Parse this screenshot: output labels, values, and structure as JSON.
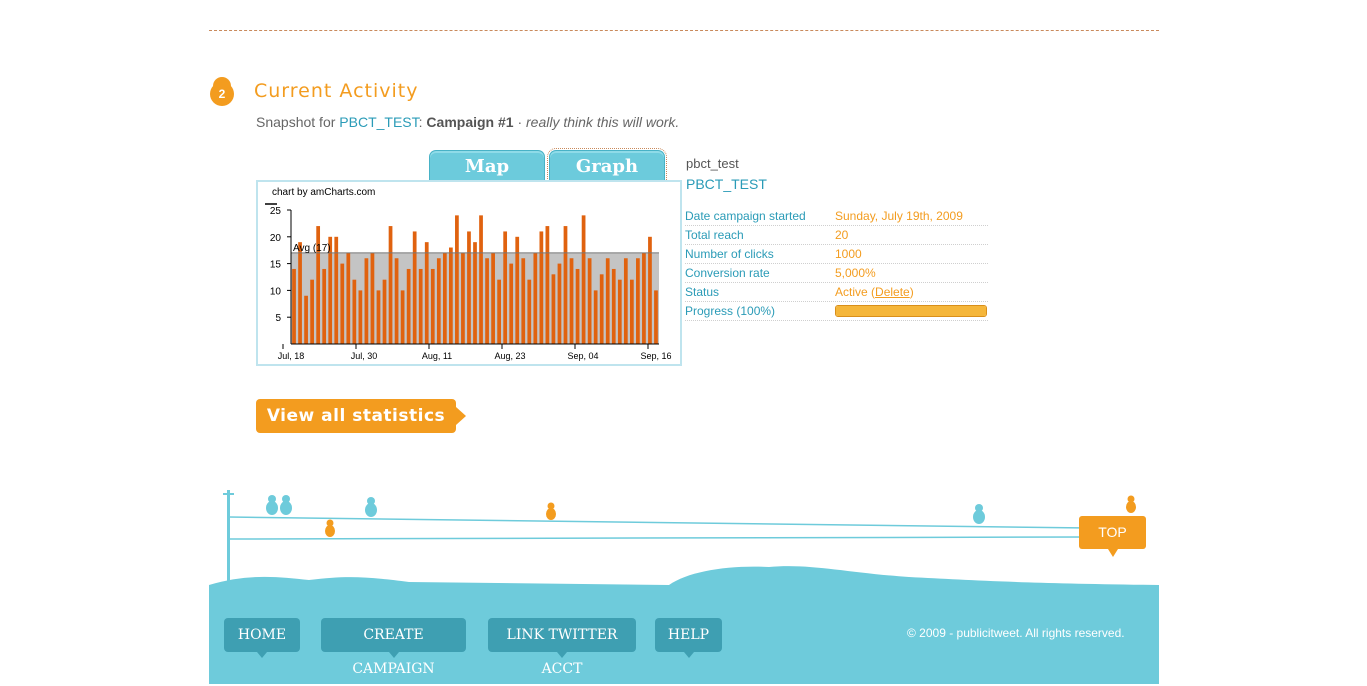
{
  "section": {
    "number": "2",
    "title": "Current Activity"
  },
  "snapshot": {
    "prefix": "Snapshot for",
    "account_link": "PBCT_TEST",
    "separator": ":",
    "campaign": "Campaign #1",
    "dot": "·",
    "description": "really think this will work."
  },
  "tabs": [
    {
      "label": "Map"
    },
    {
      "label": "Graph"
    }
  ],
  "chart_credit": "chart by amCharts.com",
  "chart_data": {
    "type": "bar",
    "title": "",
    "ylim": [
      0,
      25
    ],
    "yticks": [
      5,
      10,
      15,
      20,
      25
    ],
    "xticks": [
      "Jul, 18",
      "Jul, 30",
      "Aug, 11",
      "Aug, 23",
      "Sep, 04",
      "Sep, 16"
    ],
    "average": 17,
    "average_label": "Avg (17)",
    "values": [
      14,
      19,
      9,
      12,
      22,
      14,
      20,
      20,
      15,
      17,
      12,
      10,
      16,
      17,
      10,
      12,
      22,
      16,
      10,
      14,
      21,
      14,
      19,
      14,
      16,
      17,
      18,
      24,
      17,
      21,
      19,
      24,
      16,
      17,
      12,
      21,
      15,
      20,
      16,
      12,
      17,
      21,
      22,
      13,
      15,
      22,
      16,
      14,
      24,
      16,
      10,
      13,
      16,
      14,
      12,
      16,
      12,
      16,
      17,
      20,
      10
    ],
    "colors": {
      "bar": "#e0620f",
      "avg_band": "#c4c4c4"
    }
  },
  "account": {
    "handle": "pbct_test",
    "name": "PBCT_TEST"
  },
  "stats": [
    {
      "label": "Date campaign started",
      "value": "Sunday, July 19th, 2009"
    },
    {
      "label": "Total reach",
      "value": "20"
    },
    {
      "label": "Number of clicks",
      "value": "1000"
    },
    {
      "label": "Conversion rate",
      "value": "5,000%"
    },
    {
      "label": "Status",
      "value": "Active",
      "open": "(",
      "link": "Delete",
      "close": ")"
    },
    {
      "label": "Progress (100%)",
      "progress": 1.0
    }
  ],
  "view_all_label": "View all statistics",
  "top_label": "TOP",
  "nav": [
    {
      "label": "HOME"
    },
    {
      "label": "CREATE CAMPAIGN"
    },
    {
      "label": "LINK TWITTER ACCT"
    },
    {
      "label": "HELP"
    }
  ],
  "copyright": "© 2009 - publicitweet. All rights reserved.",
  "colors": {
    "accent_orange": "#f39c1f",
    "accent_blue": "#6ecbdb",
    "link_blue": "#2a9bb7"
  }
}
